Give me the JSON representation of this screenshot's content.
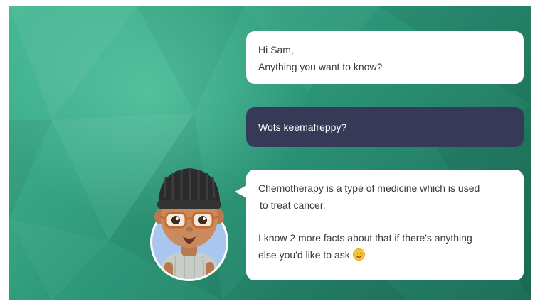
{
  "chat": {
    "greeting_line1": "Hi Sam,",
    "greeting_line2": "Anything you want to know?",
    "user_message": "Wots keemafreppy?",
    "reply_line1": "Chemotherapy is a type of medicine which is used",
    "reply_line2": "to treat cancer.",
    "reply_line3": "I know 2 more facts about that if there's anything",
    "reply_line4": "else you'd like to ask"
  },
  "icons": {
    "emoji": "smiling-face-emoji",
    "avatar": "bot-avatar-beanie-glasses"
  },
  "colors": {
    "background_light": "#46b894",
    "background_dark": "#1e6f5a",
    "bot_bubble": "#ffffff",
    "user_bubble": "#363a57",
    "bot_text": "#333a40",
    "user_text": "#ffffff"
  }
}
